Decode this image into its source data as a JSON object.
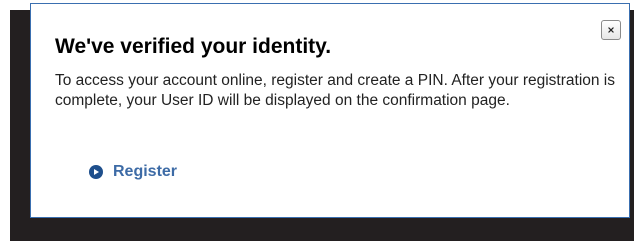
{
  "dialog": {
    "title": "We've verified your identity.",
    "message": "To access your account online, register and create a PIN. After your registration is complete, your User ID will be displayed on the confirmation page.",
    "register_label": "Register",
    "close_icon": "close-icon",
    "register_icon": "play-circle-icon"
  },
  "colors": {
    "overlay": "#231f20",
    "dialog_border": "#3a6fb0",
    "link": "#3d6ba6",
    "icon": "#1e4f8c"
  }
}
